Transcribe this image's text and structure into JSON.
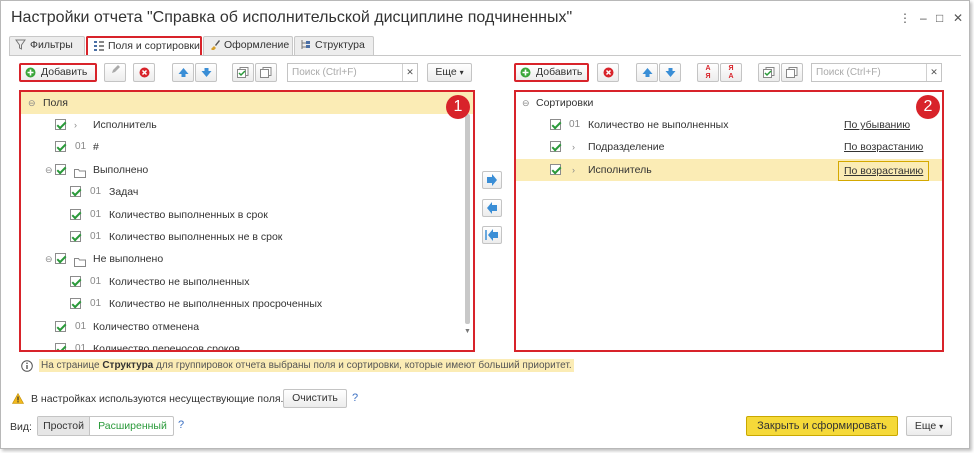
{
  "window": {
    "title": "Настройки отчета \"Справка об исполнительской дисциплине подчиненных\""
  },
  "tabs": [
    "Фильтры",
    "Поля и сортировки",
    "Оформление",
    "Структура"
  ],
  "left": {
    "add_label": "Добавить",
    "search_placeholder": "Поиск (Ctrl+F)",
    "more_label": "Еще",
    "badge": "1",
    "root": "Поля",
    "items": [
      {
        "num": "",
        "label": "Исполнитель"
      },
      {
        "num": "01",
        "label": "#"
      },
      {
        "num": "",
        "label": "Выполнено"
      },
      {
        "num": "01",
        "label": "Задач"
      },
      {
        "num": "01",
        "label": "Количество выполненных в срок"
      },
      {
        "num": "01",
        "label": "Количество выполненных не в срок"
      },
      {
        "num": "",
        "label": "Не выполнено"
      },
      {
        "num": "01",
        "label": "Количество не выполненных"
      },
      {
        "num": "01",
        "label": "Количество не выполненных просроченных"
      },
      {
        "num": "01",
        "label": "Количество отменена"
      },
      {
        "num": "01",
        "label": "Количество переносов сроков"
      }
    ]
  },
  "right": {
    "add_label": "Добавить",
    "search_placeholder": "Поиск (Ctrl+F)",
    "badge": "2",
    "root": "Сортировки",
    "items": [
      {
        "num": "01",
        "label": "Количество не выполненных",
        "order": "По убыванию"
      },
      {
        "num": "",
        "label": "Подразделение",
        "order": "По возрастанию"
      },
      {
        "num": "",
        "label": "Исполнитель",
        "order": "По возрастанию"
      }
    ]
  },
  "hint": {
    "prefix": "На странице ",
    "bold": "Структура",
    "suffix": " для группировок отчета выбраны поля и сортировки, которые имеют больший приоритет."
  },
  "warning": {
    "text": "В настройках используются несуществующие поля.",
    "clear_label": "Очистить",
    "help": "?"
  },
  "view": {
    "label": "Вид:",
    "simple": "Простой",
    "advanced": "Расширенный",
    "help": "?"
  },
  "footer": {
    "primary": "Закрыть и сформировать",
    "more": "Еще"
  }
}
